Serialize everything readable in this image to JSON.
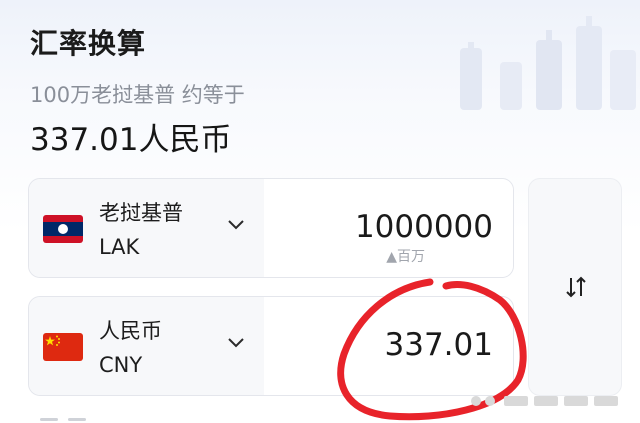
{
  "header": {
    "title": "汇率换算"
  },
  "summary": {
    "subtitle": "100万老挝基普 约等于",
    "result": "337.01人民币"
  },
  "from_currency": {
    "name": "老挝基普",
    "code": "LAK",
    "amount": "1000000",
    "unit_hint": "▲百万",
    "flag": "laos-flag-icon"
  },
  "to_currency": {
    "name": "人民币",
    "code": "CNY",
    "amount": "337.01",
    "flag": "china-flag-icon"
  },
  "swap": {
    "icon": "swap-arrows-icon"
  },
  "colors": {
    "annotation_red": "#e8232a",
    "laos_red": "#ce1126",
    "laos_blue": "#002868",
    "china_red": "#de2910",
    "china_yellow": "#ffde00"
  }
}
